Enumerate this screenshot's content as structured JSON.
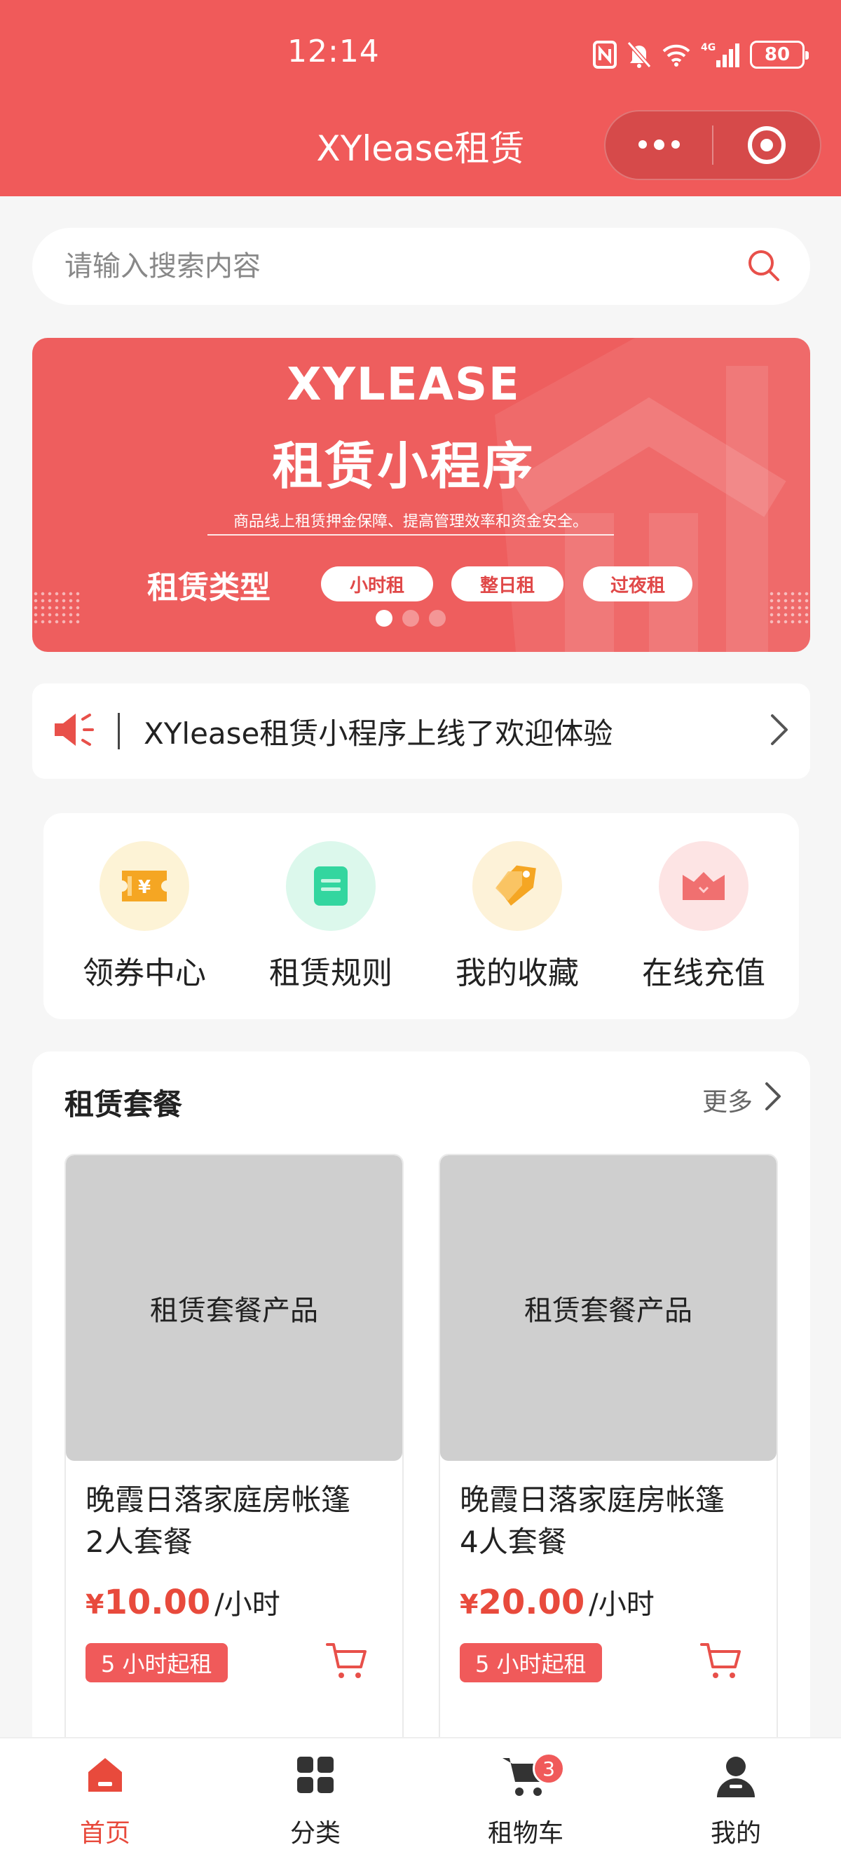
{
  "status_bar": {
    "time": "12:14",
    "battery": "80",
    "icons": [
      "nfc-icon",
      "bell-muted-icon",
      "wifi-icon",
      "signal-4g-icon",
      "battery-icon"
    ]
  },
  "nav": {
    "title": "XYlease租赁",
    "capsule_icons": [
      "more-dots-icon",
      "target-icon"
    ]
  },
  "search": {
    "placeholder": "请输入搜索内容",
    "icon": "search-icon"
  },
  "banner": {
    "title_en": "XYLEASE",
    "title_cn": "租赁小程序",
    "subtitle": "商品线上租赁押金保障、提高管理效率和资金安全。",
    "type_label": "租赁类型",
    "types": [
      "小时租",
      "整日租",
      "过夜租"
    ],
    "slide_count": 3,
    "active_slide": 0
  },
  "notice": {
    "icon": "speaker-icon",
    "text": "XYlease租赁小程序上线了欢迎体验"
  },
  "quick_entries": [
    {
      "label": "领券中心",
      "icon": "coupon-icon",
      "bg": "#fdf3d6",
      "color": "#f5a623"
    },
    {
      "label": "租赁规则",
      "icon": "rules-icon",
      "bg": "#dcf8ec",
      "color": "#33d69f"
    },
    {
      "label": "我的收藏",
      "icon": "tag-icon",
      "bg": "#fdf2d8",
      "color": "#f5a623"
    },
    {
      "label": "在线充值",
      "icon": "recharge-icon",
      "bg": "#fde4e4",
      "color": "#f07070"
    }
  ],
  "packages": {
    "title": "租赁套餐",
    "more_label": "更多",
    "items": [
      {
        "image_placeholder": "租赁套餐产品",
        "name_line1": "晚霞日落家庭房帐篷",
        "name_line2": "2人套餐",
        "currency": "¥",
        "price": "10.00",
        "unit": "/小时",
        "min_tag": "5 小时起租"
      },
      {
        "image_placeholder": "租赁套餐产品",
        "name_line1": "晚霞日落家庭房帐篷",
        "name_line2": "4人套餐",
        "currency": "¥",
        "price": "20.00",
        "unit": "/小时",
        "min_tag": "5 小时起租"
      }
    ]
  },
  "tabbar": {
    "tabs": [
      {
        "label": "首页",
        "icon": "home-icon",
        "active": true
      },
      {
        "label": "分类",
        "icon": "category-icon",
        "active": false
      },
      {
        "label": "租物车",
        "icon": "cart-icon",
        "active": false,
        "badge": "3"
      },
      {
        "label": "我的",
        "icon": "user-icon",
        "active": false
      }
    ]
  },
  "colors": {
    "brand": "#f05a5a",
    "price": "#e84a3c",
    "page_bg": "#f6f6f6"
  }
}
